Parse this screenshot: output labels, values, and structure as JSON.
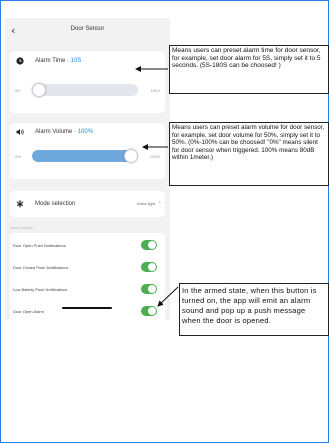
{
  "header": {
    "back_icon": "chevron-left-icon",
    "title": "Door Sensor"
  },
  "alarm_time": {
    "icon": "clock-icon",
    "label": "Alarm Time · ",
    "value": "10S",
    "min_label": "5S",
    "max_label": "180S",
    "level_fraction": 0.03
  },
  "alarm_volume": {
    "icon": "speaker-icon",
    "label": "Alarm Volume · ",
    "value": "100%",
    "min_label": "0%",
    "max_label": "100%",
    "level_fraction": 1.0
  },
  "mode": {
    "icon": "mode-icon",
    "label": "Mode selection",
    "value": "Voice light",
    "chevron_icon": "chevron-right-icon"
  },
  "notice": {
    "section_label": "Notice switch",
    "rows": [
      {
        "label": "Door Open Push Notifications",
        "on": true
      },
      {
        "label": "Door Closed Push Notifications",
        "on": true
      },
      {
        "label": "Low Battery Push Notifications",
        "on": true
      },
      {
        "label": "Door Open Alarm",
        "on": true
      }
    ]
  },
  "annotations": {
    "alarm_time_note": "Means users can preset alarm time for door sensor, for example, set door alarm for 5S, simply set it to 5 seconds. (5S-180S can be choosed! )",
    "alarm_volume_note": "Means users can preset alarm volume for door sensor, for example, set door volume for 50%, simply set it to 50%. (0%-100% can be choosed! \"0%\" means silent for door sensor when triggered. 100% means 80dB within 1meter.)",
    "door_open_alarm_note": "In the armed state, when this button is turned on, the app will emit an alarm sound and pop up a push message when the door is opened."
  },
  "colors": {
    "accent": "#2a86e8",
    "toggle_on": "#4caf50",
    "frame": "#2a7de1"
  }
}
